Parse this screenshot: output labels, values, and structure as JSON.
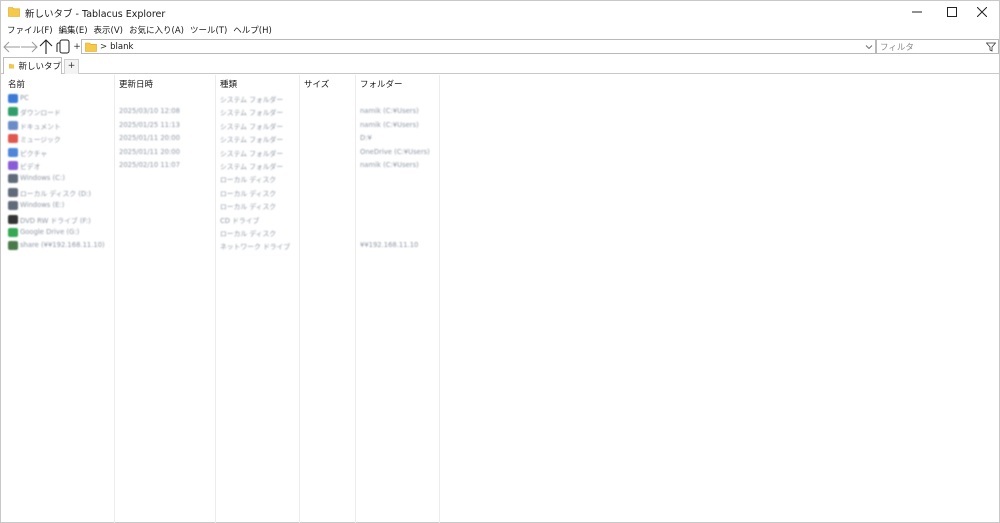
{
  "window": {
    "title": "新しいタブ - Tablacus Explorer",
    "icon": "folder-icon",
    "controls": [
      "minimize-icon",
      "maximize-icon",
      "close-icon"
    ]
  },
  "menu": [
    "ファイル(F)",
    "編集(E)",
    "表示(V)",
    "お気に入り(A)",
    "ツール(T)",
    "ヘルプ(H)"
  ],
  "toolbar": {
    "plus_label": "+",
    "address_sep": ">",
    "address_value": "blank",
    "filter_placeholder": "フィルタ"
  },
  "tabs": {
    "items": [
      {
        "label": "新しいタブ"
      }
    ],
    "add_label": "+"
  },
  "columns": [
    "名前",
    "更新日時",
    "種類",
    "サイズ",
    "フォルダー"
  ],
  "rows": [
    {
      "name": "PC",
      "date": "",
      "type": "システム フォルダー",
      "size": "",
      "folder": "",
      "icon_color": "#3a7bd5"
    },
    {
      "name": "ダウンロード",
      "date": "2025/03/10 12:08",
      "type": "システム フォルダー",
      "size": "",
      "folder": "namik (C:¥Users)",
      "icon_color": "#2f9e6a"
    },
    {
      "name": "ドキュメント",
      "date": "2025/01/25 11:13",
      "type": "システム フォルダー",
      "size": "",
      "folder": "namik (C:¥Users)",
      "icon_color": "#6b8cc7"
    },
    {
      "name": "ミュージック",
      "date": "2025/01/11 20:00",
      "type": "システム フォルダー",
      "size": "",
      "folder": "D:¥",
      "icon_color": "#e0574f"
    },
    {
      "name": "ピクチャ",
      "date": "2025/01/11 20:00",
      "type": "システム フォルダー",
      "size": "",
      "folder": "OneDrive (C:¥Users)",
      "icon_color": "#4f86d9"
    },
    {
      "name": "ビデオ",
      "date": "2025/02/10 11:07",
      "type": "システム フォルダー",
      "size": "",
      "folder": "namik (C:¥Users)",
      "icon_color": "#8a5bd6"
    },
    {
      "name": "Windows (C:)",
      "date": "",
      "type": "ローカル ディスク",
      "size": "",
      "folder": "",
      "icon_color": "#5f6b7a"
    },
    {
      "name": "ローカル ディスク (D:)",
      "date": "",
      "type": "ローカル ディスク",
      "size": "",
      "folder": "",
      "icon_color": "#5f6b7a"
    },
    {
      "name": "Windows (E:)",
      "date": "",
      "type": "ローカル ディスク",
      "size": "",
      "folder": "",
      "icon_color": "#5f6b7a"
    },
    {
      "name": "DVD RW ドライブ (F:)",
      "date": "",
      "type": "CD ドライブ",
      "size": "",
      "folder": "",
      "icon_color": "#333333"
    },
    {
      "name": "Google Drive (G:)",
      "date": "",
      "type": "ローカル ディスク",
      "size": "",
      "folder": "",
      "icon_color": "#34a853"
    },
    {
      "name": "share (¥¥192.168.11.10)",
      "date": "",
      "type": "ネットワーク ドライブ",
      "size": "",
      "folder": "¥¥192.168.11.10",
      "icon_color": "#4a7a4a"
    }
  ]
}
